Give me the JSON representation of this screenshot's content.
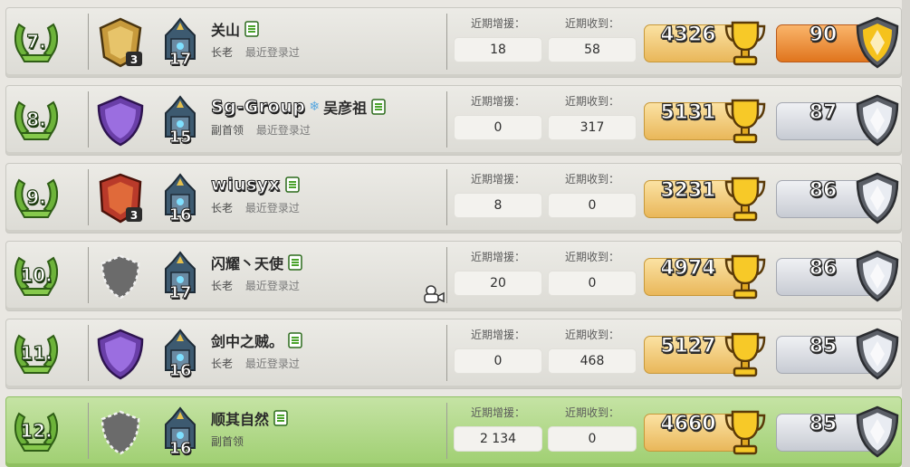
{
  "colors": {
    "row_bg": "#e4e3de",
    "highlight_bg": "#b3d98a",
    "rank_wreath": "#7cc142",
    "trophy_pill": "#f2c86f",
    "war_pill_silver": "#dcdfe5",
    "war_pill_gold": "#ee8e35"
  },
  "labels": {
    "donated": "近期增援：",
    "received": "近期收到："
  },
  "members": [
    {
      "rank": "7.",
      "league_icon": "titan-league-icon",
      "league_num": "3",
      "th_icon": "town-hall-17-icon",
      "th_level": "17",
      "name_cjk": "关山",
      "name_latin": "",
      "name_suffix": "",
      "role": "长老",
      "last_seen": "最近登录过",
      "donated": "18",
      "received": "58",
      "trophies": "4326",
      "war_stars": "90",
      "war_icon": "gold-war-league-icon",
      "highlight": false,
      "spectate": false
    },
    {
      "rank": "8.",
      "league_icon": "legend-league-icon",
      "league_num": "",
      "th_icon": "town-hall-15-icon",
      "th_level": "15",
      "name_cjk": "",
      "name_latin": "Sg-Group",
      "name_suffix": "吴彦祖",
      "role": "副首领",
      "last_seen": "最近登录过",
      "donated": "0",
      "received": "317",
      "trophies": "5131",
      "war_stars": "87",
      "war_icon": "silver-war-league-icon",
      "highlight": false,
      "spectate": false
    },
    {
      "rank": "9.",
      "league_icon": "champion-league-icon",
      "league_num": "3",
      "th_icon": "town-hall-16-icon",
      "th_level": "16",
      "name_cjk": "",
      "name_latin": "wiusyx",
      "name_suffix": "",
      "role": "长老",
      "last_seen": "最近登录过",
      "donated": "8",
      "received": "0",
      "trophies": "3231",
      "war_stars": "86",
      "war_icon": "silver-war-league-icon",
      "highlight": false,
      "spectate": false
    },
    {
      "rank": "10.",
      "league_icon": "unranked-league-icon",
      "league_num": "",
      "th_icon": "town-hall-17-icon",
      "th_level": "17",
      "name_cjk": "闪耀丶天使",
      "name_latin": "",
      "name_suffix": "",
      "role": "长老",
      "last_seen": "最近登录过",
      "donated": "20",
      "received": "0",
      "trophies": "4974",
      "war_stars": "86",
      "war_icon": "silver-war-league-icon",
      "highlight": false,
      "spectate": true
    },
    {
      "rank": "11.",
      "league_icon": "legend-league-icon",
      "league_num": "",
      "th_icon": "town-hall-16-icon",
      "th_level": "16",
      "name_cjk": "剑中之贼。",
      "name_latin": "",
      "name_suffix": "",
      "role": "长老",
      "last_seen": "最近登录过",
      "donated": "0",
      "received": "468",
      "trophies": "5127",
      "war_stars": "85",
      "war_icon": "silver-war-league-icon",
      "highlight": false,
      "spectate": false
    },
    {
      "rank": "12.",
      "league_icon": "unranked-league-icon",
      "league_num": "",
      "th_icon": "town-hall-16-icon",
      "th_level": "16",
      "name_cjk": "顺其自然",
      "name_latin": "",
      "name_suffix": "",
      "role": "副首领",
      "last_seen": "",
      "donated": "2 134",
      "received": "0",
      "trophies": "4660",
      "war_stars": "85",
      "war_icon": "silver-war-league-icon",
      "highlight": true,
      "spectate": false
    }
  ]
}
